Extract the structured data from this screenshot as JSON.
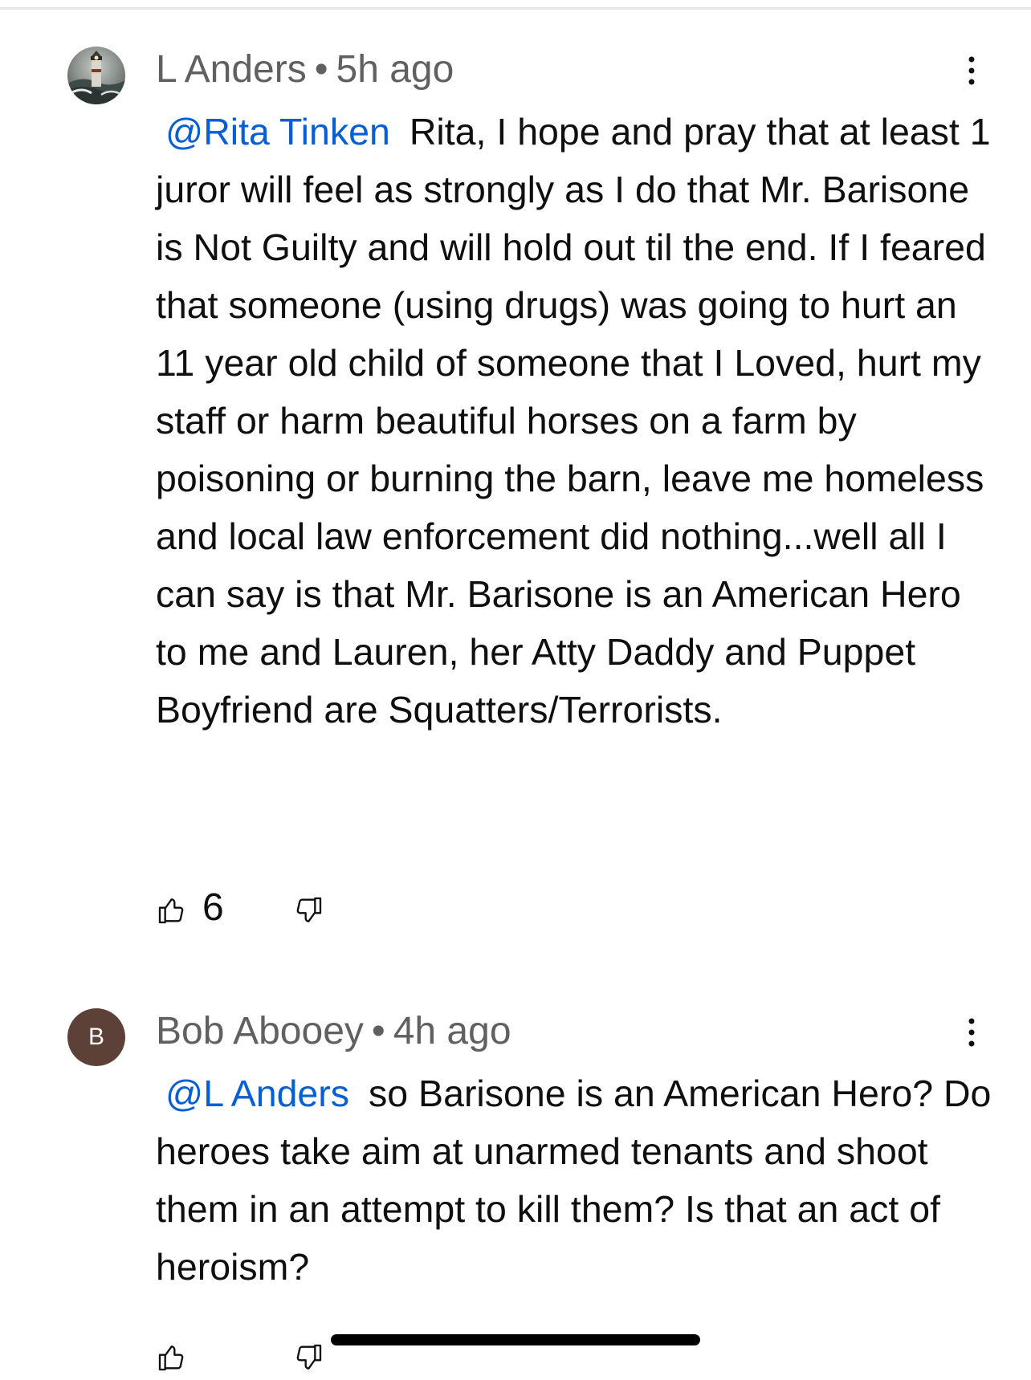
{
  "comments": [
    {
      "author": "L Anders",
      "separator": "•",
      "time": "5h ago",
      "avatar_icon": "lighthouse-photo",
      "mention": "@Rita Tinken",
      "text": "Rita, I hope and pray that at least 1 juror will feel as strongly as I do that Mr. Barisone is Not Guilty and will hold out til the end. If I feared that someone (using drugs) was going to hurt an 11 year old child of someone that I Loved, hurt my staff or harm beautiful horses on a farm by poisoning or burning the barn, leave me homeless and local law enforcement did nothing...well all I can say is that Mr. Barisone is an American Hero to me and Lauren, her Atty Daddy and Puppet Boyfriend are Squatters/Terrorists.",
      "likes": "6"
    },
    {
      "author": "Bob Abooey",
      "separator": "•",
      "time": "4h ago",
      "avatar_letter": "B",
      "avatar_color": "#5d4037",
      "mention": "@L Anders",
      "text": "so Barisone is an American Hero? Do heroes take aim at unarmed tenants and shoot them in an attempt to kill them? Is that an act of heroism?",
      "likes": ""
    }
  ],
  "colors": {
    "mention": "#065fd4",
    "meta_text": "#606060",
    "body_text": "#0f0f0f"
  },
  "icons": {
    "like": "thumbs-up-icon",
    "dislike": "thumbs-down-icon",
    "more": "more-vertical-icon"
  }
}
